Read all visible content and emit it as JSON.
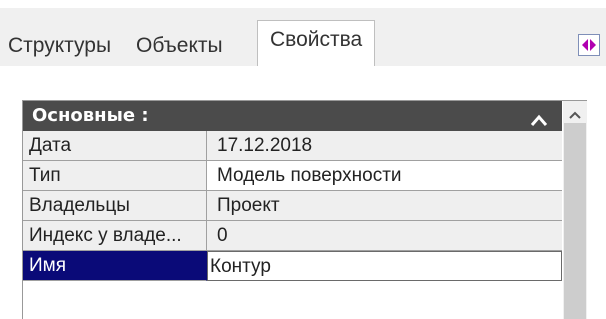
{
  "tabs": [
    {
      "label": "Структуры"
    },
    {
      "label": "Объекты"
    },
    {
      "label": "Свойства"
    }
  ],
  "active_tab": "Свойства",
  "group": {
    "title": "Основные :"
  },
  "properties": [
    {
      "key": "Дата",
      "value": "17.12.2018"
    },
    {
      "key": "Тип",
      "value": "Модель поверхности"
    },
    {
      "key": "Владельцы",
      "value": "Проект"
    },
    {
      "key": "Индекс у владе...",
      "value": "0"
    },
    {
      "key": "Имя",
      "value": "Контур"
    }
  ],
  "icons": {
    "pin": "pin-icon",
    "collapse": "chevron-up-icon",
    "scroll_up": "scroll-up-arrow-icon"
  },
  "colors": {
    "header_bg": "#4b4b4b",
    "selected_bg": "#0a0a78",
    "pin_accent": "#b000b0"
  }
}
